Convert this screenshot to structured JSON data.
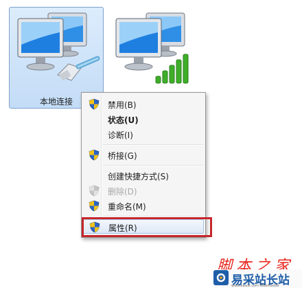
{
  "network_icons": [
    {
      "label": "本地连接",
      "selected": true
    },
    {
      "label": "",
      "selected": false
    }
  ],
  "context_menu": {
    "items": [
      {
        "label": "禁用(B)",
        "shield": true,
        "bold": false,
        "disabled": false
      },
      {
        "label": "状态(U)",
        "shield": false,
        "bold": true,
        "disabled": false
      },
      {
        "label": "诊断(I)",
        "shield": false,
        "bold": false,
        "disabled": false
      },
      {
        "label": "桥接(G)",
        "shield": true,
        "bold": false,
        "disabled": false
      },
      {
        "label": "创建快捷方式(S)",
        "shield": false,
        "bold": false,
        "disabled": false
      },
      {
        "label": "删除(D)",
        "shield": true,
        "bold": false,
        "disabled": true
      },
      {
        "label": "重命名(M)",
        "shield": true,
        "bold": false,
        "disabled": false
      },
      {
        "label": "属性(R)",
        "shield": true,
        "bold": false,
        "disabled": false,
        "hover": true
      }
    ]
  },
  "watermark": {
    "script_text": "脚本之家",
    "logo_text": "易采站长站",
    "logo_sub": "www.easck.com Webmaster"
  },
  "colors": {
    "selection_bg": "#c3dcf6",
    "highlight_frame": "#c6262b",
    "shield_blue": "#2a64c5",
    "shield_yellow": "#f2c21b"
  }
}
